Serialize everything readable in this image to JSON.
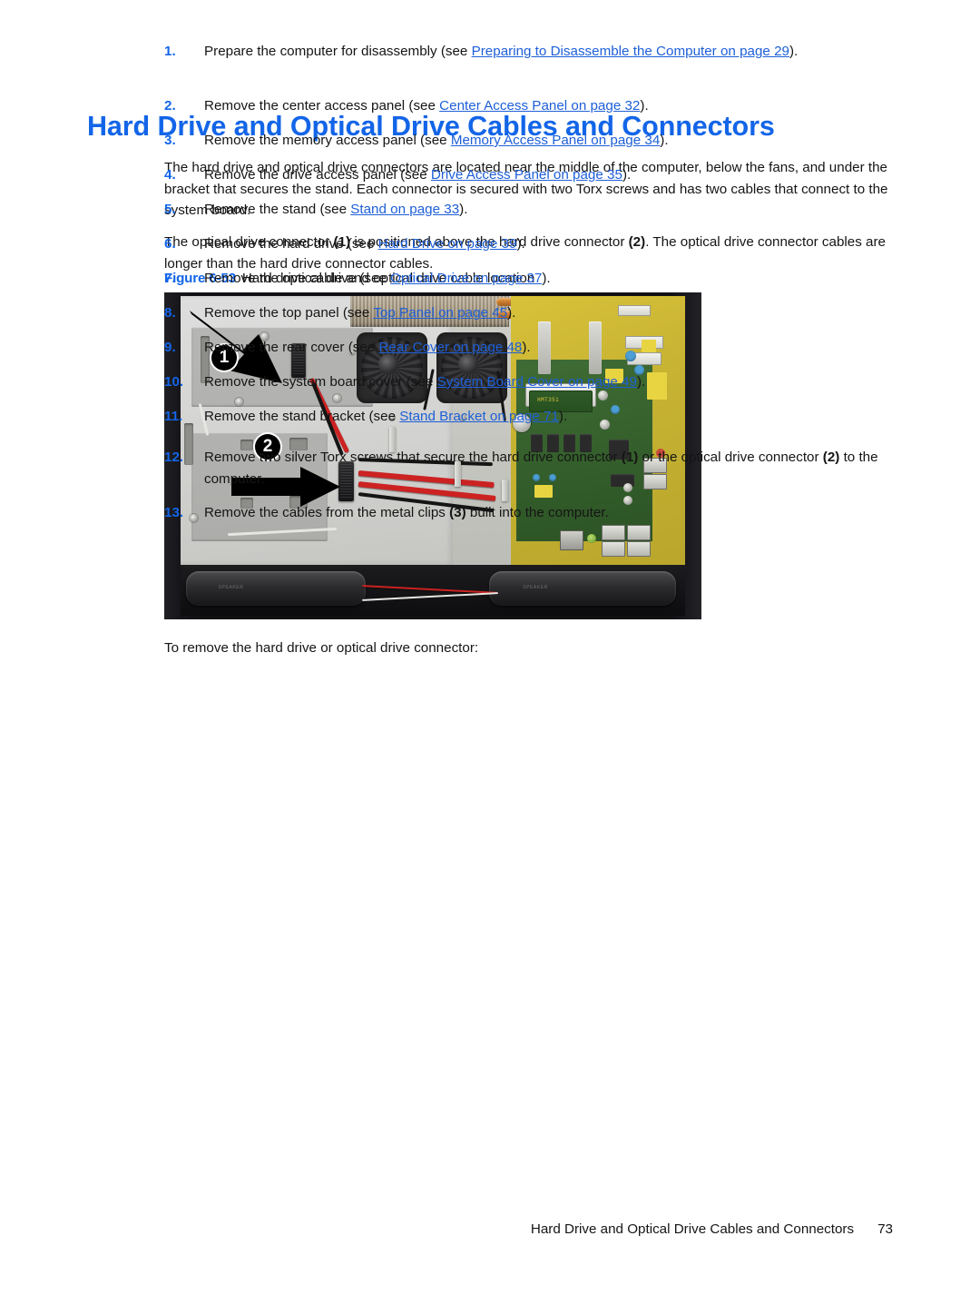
{
  "document": {
    "heading": "Hard Drive and Optical Drive Cables and Connectors",
    "paragraphs": {
      "intro": "The hard drive and optical drive connectors are located near the middle of the computer, below the fans, and under the bracket that secures the stand. Each connector is secured with two Torx screws and has two cables that connect to the system board.",
      "position_pre": "The optical drive connector ",
      "position_ref1": "(1)",
      "position_mid": " is positioned above the hard drive connector ",
      "position_ref2": "(2)",
      "position_post": ". The optical drive connector cables are longer than the hard drive connector cables.",
      "lead_in": "To remove the hard drive or optical drive connector:"
    },
    "figure": {
      "label": "Figure 6-53",
      "caption": "Hard drive cable and optical drive cable location",
      "callouts": [
        {
          "number": "1",
          "meaning": "optical drive connector"
        },
        {
          "number": "2",
          "meaning": "hard drive connector"
        }
      ],
      "alt": "Photo of computer interior showing hard drive cable and optical drive cable location"
    },
    "steps": [
      {
        "number": "1.",
        "pre": "Prepare the computer for disassembly (see ",
        "link": "Preparing to Disassemble the Computer on page 29",
        "post": ")."
      },
      {
        "number": "2.",
        "pre": "Remove the center access panel (see ",
        "link": "Center Access Panel on page 32",
        "post": ")."
      },
      {
        "number": "3.",
        "pre": "Remove the memory access panel (see ",
        "link": "Memory Access Panel on page 34",
        "post": ")."
      },
      {
        "number": "4.",
        "pre": "Remove the drive access panel (see ",
        "link": "Drive Access Panel on page 35",
        "post": ")."
      },
      {
        "number": "5.",
        "pre": "Remove the stand (see ",
        "link": "Stand on page 33",
        "post": ")."
      },
      {
        "number": "6.",
        "pre": "Remove the hard drive (see ",
        "link": "Hard Drive on page 39",
        "post": ")."
      },
      {
        "number": "7.",
        "pre": "Remove the optical drive (see ",
        "link": "Optical Drive on page 37",
        "post": ")."
      },
      {
        "number": "8.",
        "pre": "Remove the top panel (see ",
        "link": "Top Panel on page 45",
        "post": ")."
      },
      {
        "number": "9.",
        "pre": "Remove the rear cover (see ",
        "link": "Rear Cover on page 48",
        "post": ")."
      },
      {
        "number": "10.",
        "pre": "Remove the system board cover (see ",
        "link": "System Board Cover on page 49",
        "post": ")."
      },
      {
        "number": "11.",
        "pre": "Remove the stand bracket (see ",
        "link": "Stand Bracket on page 71",
        "post": ")."
      },
      {
        "number": "12.",
        "pre": "Remove two silver Torx screws that secure the hard drive connector ",
        "bold1": "(1)",
        "mid": " or the optical drive connector ",
        "bold2": "(2)",
        "post": " to the computer."
      },
      {
        "number": "13.",
        "pre": "Remove the cables from the metal clips ",
        "bold1": "(3)",
        "post": " built into the computer."
      }
    ],
    "footer": {
      "title": "Hard Drive and Optical Drive Cables and Connectors",
      "page": "73"
    },
    "colors": {
      "heading_blue": "#1365E8",
      "link_blue": "#1E5FD8",
      "body_black": "#151515",
      "page_background": "#FFFFFF"
    }
  }
}
